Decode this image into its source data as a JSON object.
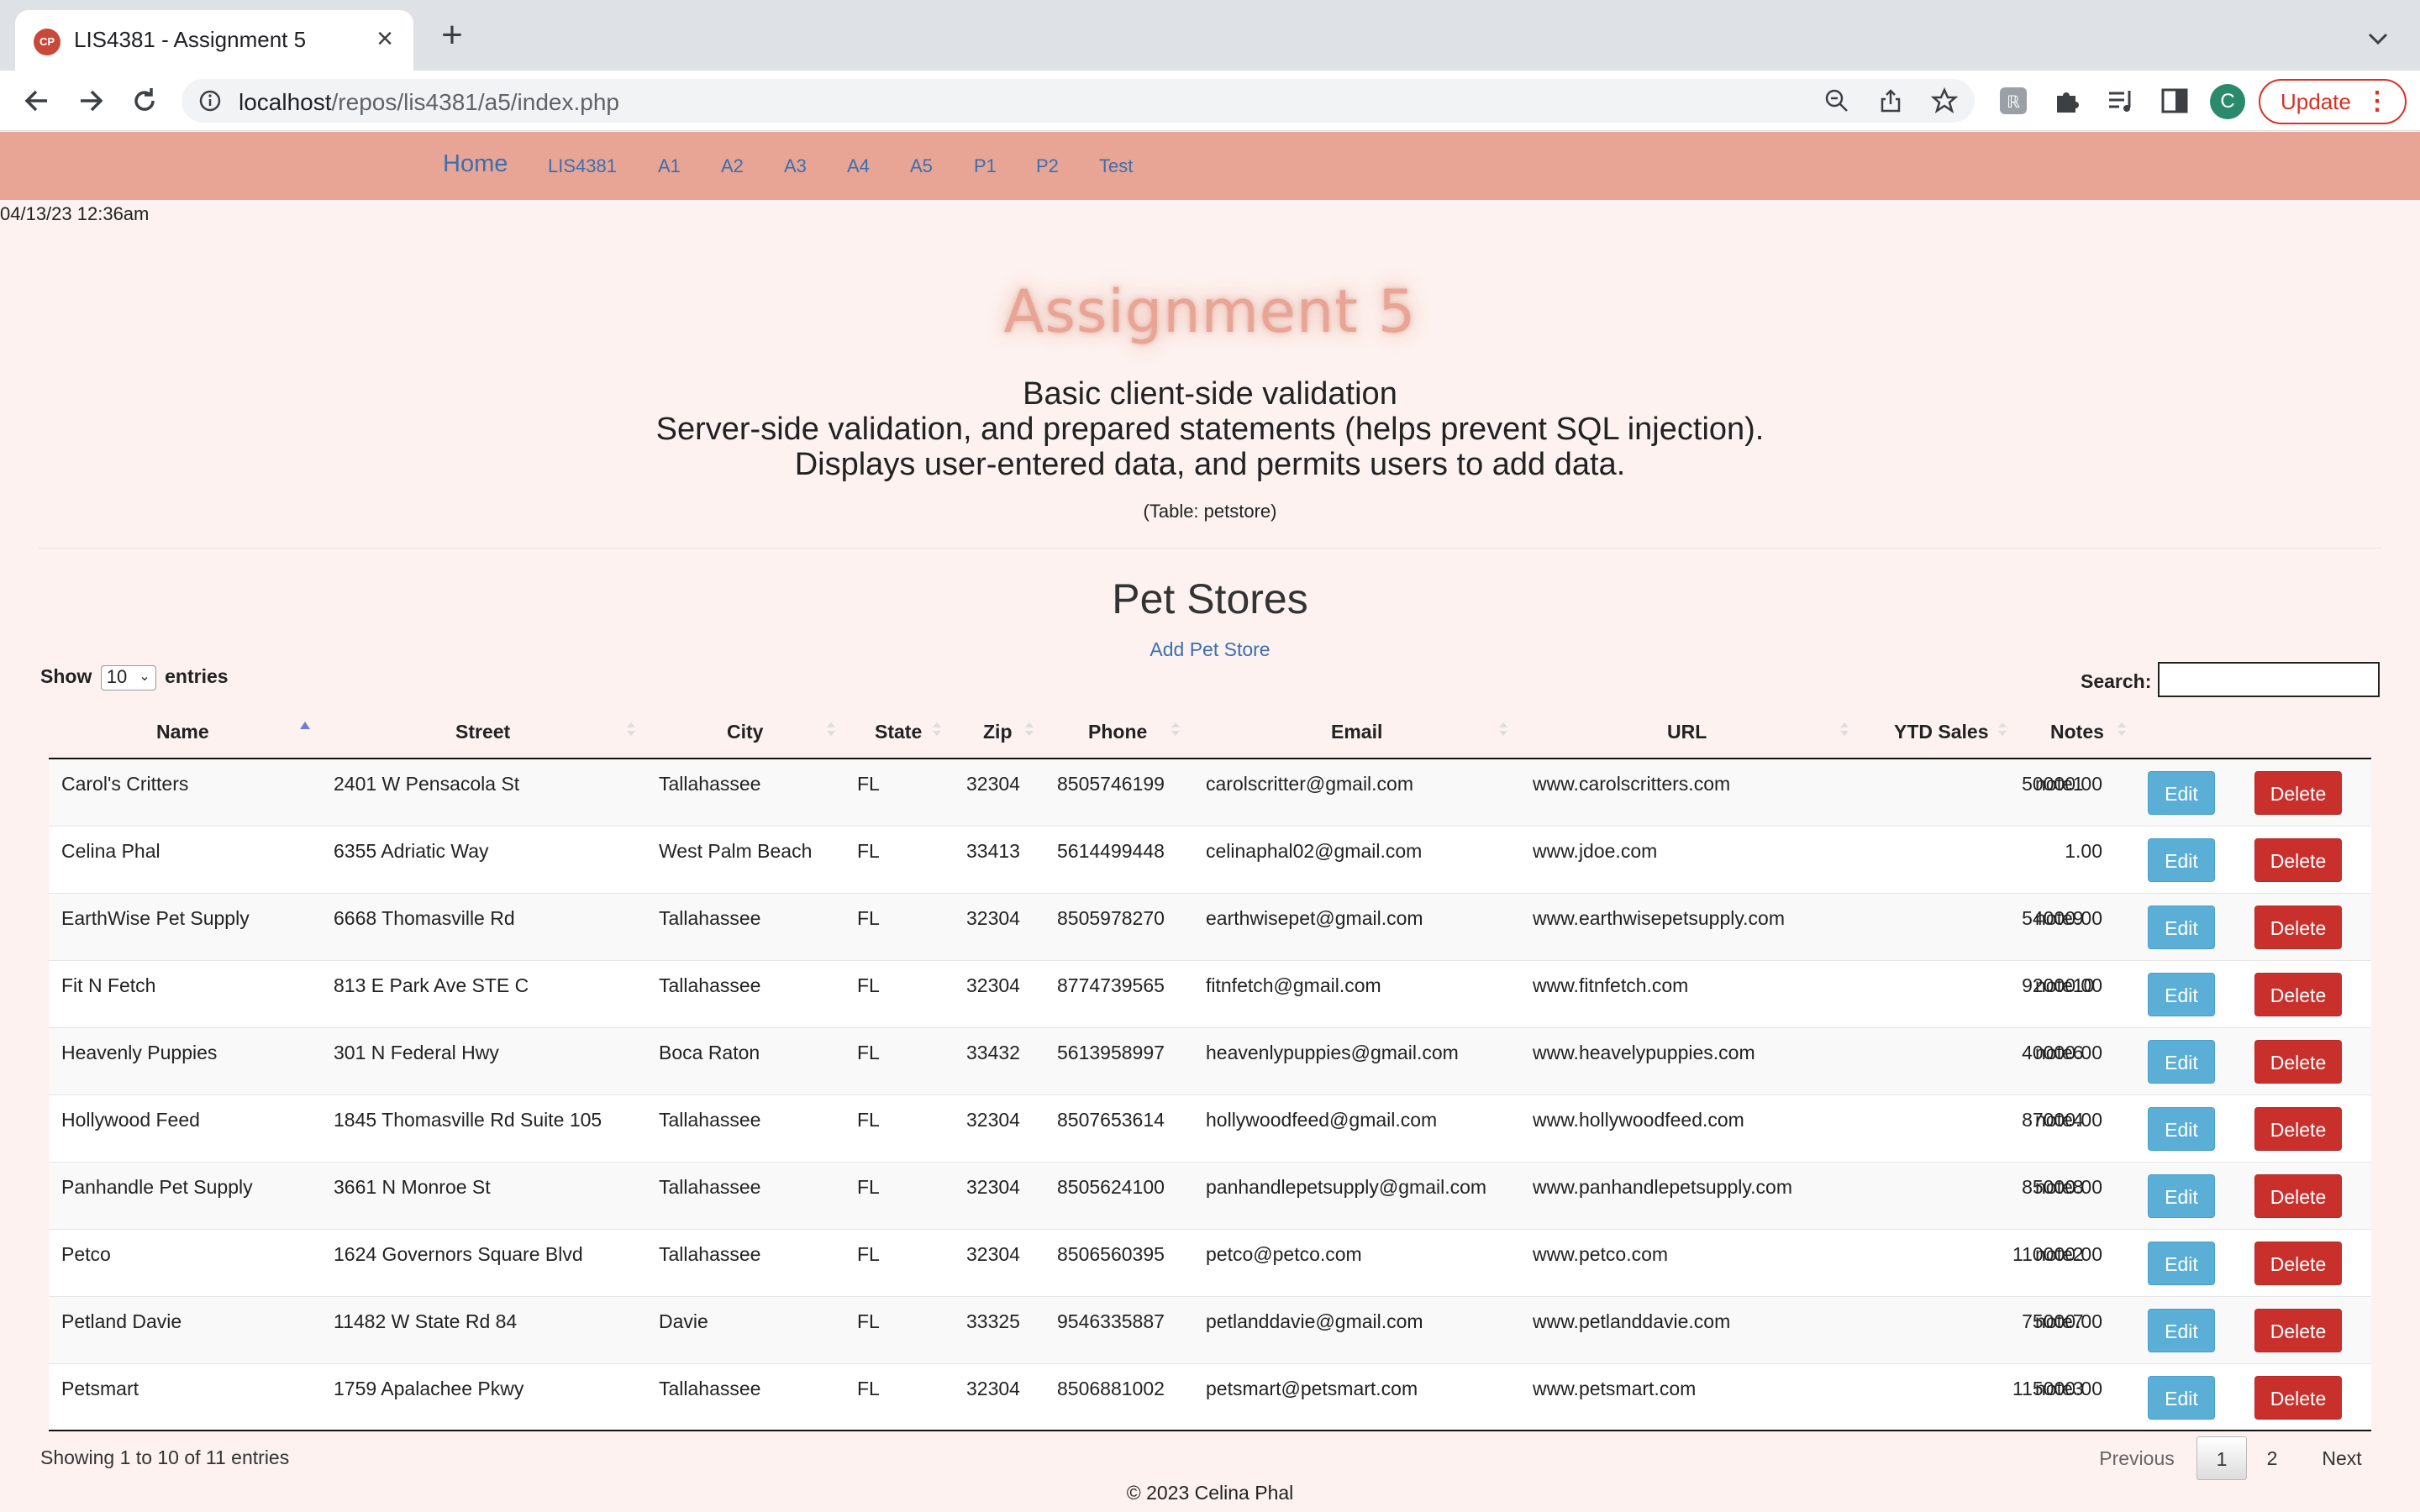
{
  "browser": {
    "tab_title": "LIS4381 - Assignment 5",
    "tab_favicon_text": "CP",
    "url_host": "localhost",
    "url_path": "/repos/lis4381/a5/index.php",
    "update_label": "Update",
    "profile_initial": "C"
  },
  "nav": {
    "home": "Home",
    "items": [
      "LIS4381",
      "A1",
      "A2",
      "A3",
      "A4",
      "A5",
      "P1",
      "P2",
      "Test"
    ]
  },
  "timestamp": "04/13/23 12:36am",
  "header": {
    "title": "Assignment 5",
    "lines": [
      "Basic client-side validation",
      "Server-side validation, and prepared statements (helps prevent SQL injection).",
      "Displays user-entered data, and permits users to add data."
    ],
    "table_note": "(Table: petstore)"
  },
  "section": {
    "title": "Pet Stores",
    "add_link": "Add Pet Store"
  },
  "controls": {
    "show_label": "Show",
    "entries_label": "entries",
    "page_length": "10",
    "search_label": "Search:"
  },
  "table": {
    "columns": [
      "Name",
      "Street",
      "City",
      "State",
      "Zip",
      "Phone",
      "Email",
      "URL",
      "YTD Sales",
      "Notes"
    ],
    "edit_label": "Edit",
    "delete_label": "Delete",
    "rows": [
      [
        "Carol's Critters",
        "2401 W Pensacola St",
        "Tallahassee",
        "FL",
        "32304",
        "8505746199",
        "carolscritter@gmail.com",
        "www.carolscritters.com",
        "50000.00",
        "note1"
      ],
      [
        "Celina Phal",
        "6355 Adriatic Way",
        "West Palm Beach",
        "FL",
        "33413",
        "5614499448",
        "celinaphal02@gmail.com",
        "www.jdoe.com",
        "1.00",
        ""
      ],
      [
        "EarthWise Pet Supply",
        "6668 Thomasville Rd",
        "Tallahassee",
        "FL",
        "32304",
        "8505978270",
        "earthwisepet@gmail.com",
        "www.earthwisepetsupply.com",
        "54000.00",
        "note9"
      ],
      [
        "Fit N Fetch",
        "813 E Park Ave STE C",
        "Tallahassee",
        "FL",
        "32304",
        "8774739565",
        "fitnfetch@gmail.com",
        "www.fitnfetch.com",
        "92000.00",
        "note10"
      ],
      [
        "Heavenly Puppies",
        "301 N Federal Hwy",
        "Boca Raton",
        "FL",
        "33432",
        "5613958997",
        "heavenlypuppies@gmail.com",
        "www.heavelypuppies.com",
        "40000.00",
        "note6"
      ],
      [
        "Hollywood Feed",
        "1845 Thomasville Rd Suite 105",
        "Tallahassee",
        "FL",
        "32304",
        "8507653614",
        "hollywoodfeed@gmail.com",
        "www.hollywoodfeed.com",
        "87000.00",
        "note4"
      ],
      [
        "Panhandle Pet Supply",
        "3661 N Monroe St",
        "Tallahassee",
        "FL",
        "32304",
        "8505624100",
        "panhandlepetsupply@gmail.com",
        "www.panhandlepetsupply.com",
        "85000.00",
        "note8"
      ],
      [
        "Petco",
        "1624 Governors Square Blvd",
        "Tallahassee",
        "FL",
        "32304",
        "8506560395",
        "petco@petco.com",
        "www.petco.com",
        "110000.00",
        "note2"
      ],
      [
        "Petland Davie",
        "11482 W State Rd 84",
        "Davie",
        "FL",
        "33325",
        "9546335887",
        "petlanddavie@gmail.com",
        "www.petlanddavie.com",
        "75000.00",
        "note7"
      ],
      [
        "Petsmart",
        "1759 Apalachee Pkwy",
        "Tallahassee",
        "FL",
        "32304",
        "8506881002",
        "petsmart@petsmart.com",
        "www.petsmart.com",
        "115000.00",
        "note3"
      ]
    ]
  },
  "pagination": {
    "info": "Showing 1 to 10 of 11 entries",
    "previous": "Previous",
    "pages": [
      "1",
      "2"
    ],
    "next": "Next"
  },
  "footer": "© 2023 Celina Phal",
  "colors": {
    "nav_bg": "#e8a595",
    "page_bg": "#fdf2ef",
    "link": "#3a6fb0",
    "edit_btn": "#5bafd6",
    "delete_btn": "#c9302c"
  }
}
